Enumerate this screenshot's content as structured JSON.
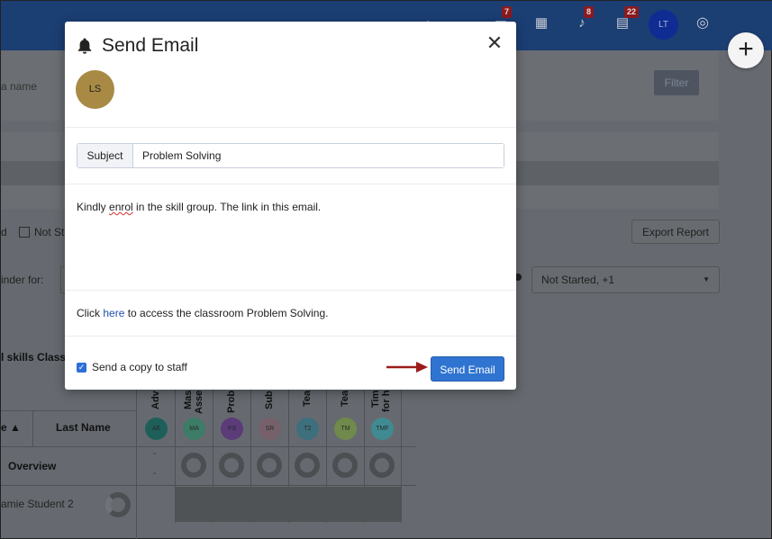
{
  "topbar": {
    "badges": {
      "messages": "7",
      "notifications": "8",
      "books": "22"
    },
    "avatar_initials": "LT"
  },
  "background": {
    "search_placeholder": "a name",
    "filter_label": "Filter",
    "status_fragment_left": "d",
    "status_option_label": "Not St",
    "export_label": "Export Report",
    "reminder_label": "inder for:",
    "status_select_value": "Not Started, +1",
    "skills_heading": "l skills Class",
    "grid": {
      "sort_col": "e ▲",
      "last_name_col": "Last Name",
      "overview_label": "Overview",
      "student_name": "amie Student 2",
      "columns": [
        {
          "head": "Adv",
          "initials": "AE",
          "color": "#1e5f5a"
        },
        {
          "head": "Mas Asse",
          "initials": "MA",
          "color": "#3d7c66"
        },
        {
          "head": "Prob",
          "initials": "PS",
          "color": "#5b3b78"
        },
        {
          "head": "Sub",
          "initials": "SR",
          "color": "#76606a"
        },
        {
          "head": "Tea",
          "initials": "T2",
          "color": "#3d6f7c"
        },
        {
          "head": "Tea",
          "initials": "TM",
          "color": "#6f8a4a"
        },
        {
          "head": "Tim for h",
          "initials": "TMF",
          "color": "#3f8b91"
        }
      ]
    }
  },
  "modal": {
    "title": "Send Email",
    "recipient_initials": "LS",
    "subject_label": "Subject",
    "subject_value": "Problem Solving",
    "body_text_1": "Kindly ",
    "body_text_misspelled": "enrol",
    "body_text_2": " in the skill group. The link in this email.",
    "link_prefix": "Click ",
    "link_text": "here",
    "link_suffix": " to access the classroom Problem Solving.",
    "copy_to_staff_label": "Send a copy to staff",
    "copy_to_staff_checked": true,
    "send_button_label": "Send Email",
    "accent_color": "#2f74d0",
    "arrow_color": "#9b1b1b"
  }
}
